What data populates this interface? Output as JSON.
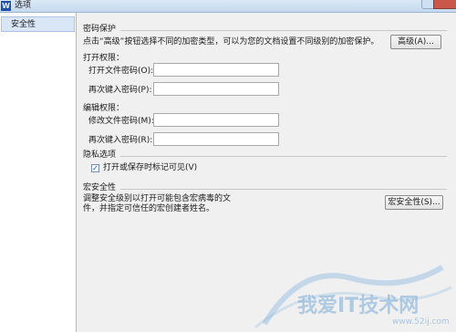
{
  "window": {
    "title": "选项",
    "app_icon": "W"
  },
  "sidebar": {
    "items": [
      {
        "label": "安全性",
        "selected": true
      }
    ]
  },
  "password_protection": {
    "title": "密码保护",
    "description": "点击“高级”按钮选择不同的加密类型，可以为您的文档设置不同级别的加密保护。",
    "advanced_button": "高级(A)...",
    "open_permission": {
      "title": "打开权限：",
      "open_password_label": "打开文件密码(O):",
      "open_password_value": "",
      "reenter_label": "再次键入密码(P):",
      "reenter_value": ""
    },
    "edit_permission": {
      "title": "编辑权限：",
      "modify_password_label": "修改文件密码(M):",
      "modify_password_value": "",
      "reenter_label": "再次键入密码(R):",
      "reenter_value": ""
    }
  },
  "privacy": {
    "title": "隐私选项",
    "checkbox_label": "打开或保存时标记可见(V)",
    "checkbox_checked": true
  },
  "macro_security": {
    "title": "宏安全性",
    "description_line1": "调整安全级别以打开可能包含宏病毒的文",
    "description_line2": "件，并指定可信任的宏创建者姓名。",
    "button": "宏安全性(S)..."
  },
  "watermark": {
    "text": "我爱IT技术网",
    "url": "www.52ij.com"
  },
  "colors": {
    "title_bar": "#c4d9ef",
    "sidebar_selected": "#d9e6f5",
    "dialog_bg": "#f0f0f0",
    "close_button": "#c9584b"
  }
}
